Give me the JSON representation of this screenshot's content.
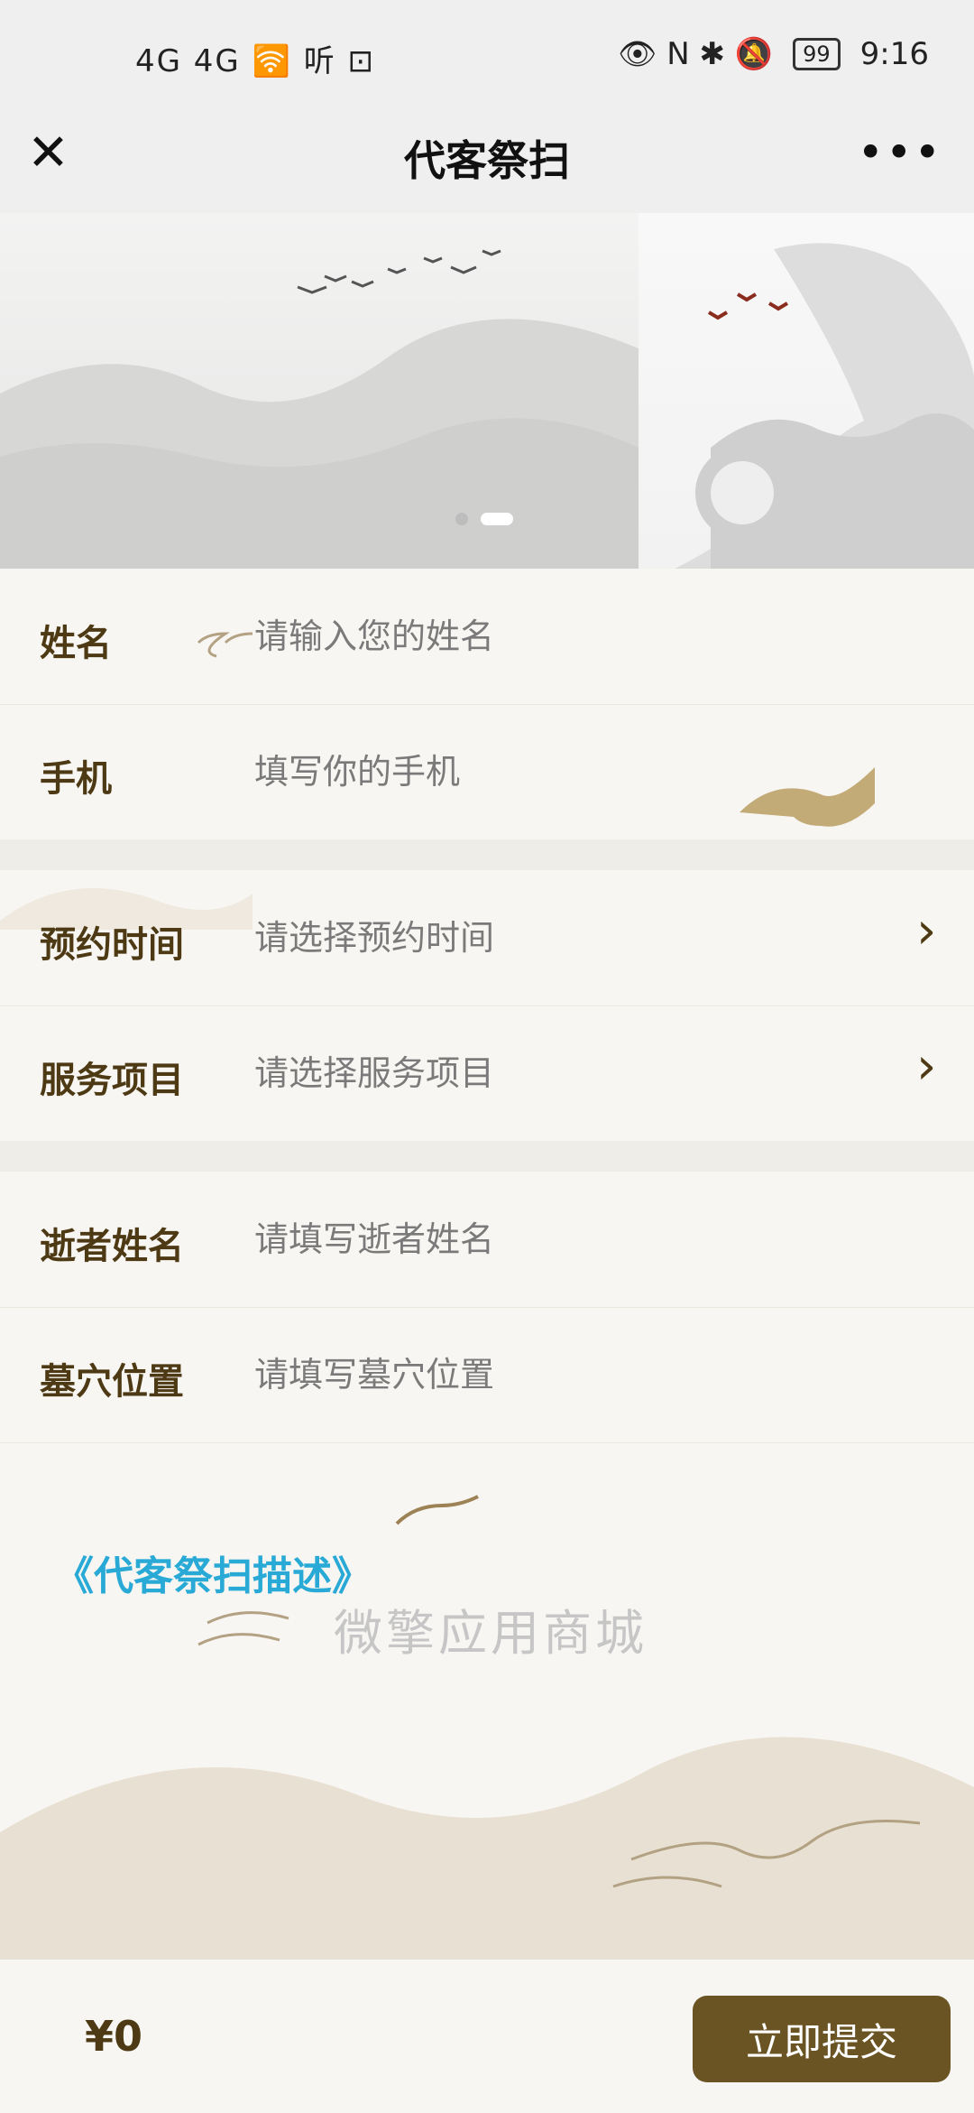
{
  "status_bar": {
    "left_icons": "4G 4G 🛜 听 ⊡",
    "right_icons": "👁 N ✱ 🔕",
    "battery": "99",
    "time": "9:16"
  },
  "title_bar": {
    "title": "代客祭扫",
    "close_icon": "close-icon",
    "more_icon": "more-icon"
  },
  "banner": {
    "dots": 2,
    "active_dot": 1
  },
  "form": {
    "name": {
      "label": "姓名",
      "placeholder": "请输入您的姓名"
    },
    "phone": {
      "label": "手机",
      "placeholder": "填写你的手机"
    },
    "appointment_time": {
      "label": "预约时间",
      "placeholder": "请选择预约时间"
    },
    "service_item": {
      "label": "服务项目",
      "placeholder": "请选择服务项目"
    },
    "deceased_name": {
      "label": "逝者姓名",
      "placeholder": "请填写逝者姓名"
    },
    "grave_location": {
      "label": "墓穴位置",
      "placeholder": "请填写墓穴位置"
    }
  },
  "description_link": "《代客祭扫描述》",
  "watermark": "微擎应用商城",
  "footer": {
    "price": "¥0",
    "submit_label": "立即提交"
  },
  "colors": {
    "label": "#4d3a14",
    "submit_bg": "#6a5424",
    "link": "#28a9d6"
  }
}
